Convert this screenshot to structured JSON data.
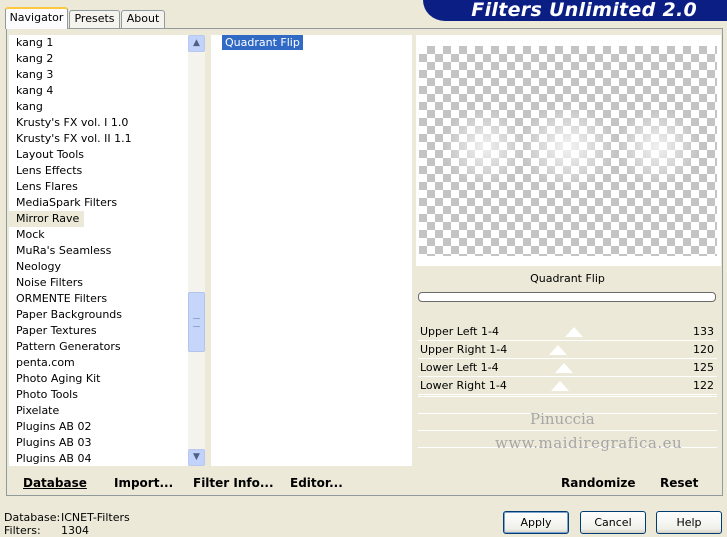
{
  "tabs": [
    "Navigator",
    "Presets",
    "About"
  ],
  "banner_title": "Filters Unlimited 2.0",
  "categories": [
    "kang 1",
    "kang 2",
    "kang 3",
    "kang 4",
    "kang",
    "Krusty's FX vol. I 1.0",
    "Krusty's FX vol. II 1.1",
    "Layout Tools",
    "Lens Effects",
    "Lens Flares",
    "MediaSpark Filters",
    "Mirror Rave",
    "Mock",
    "MuRa's Seamless",
    "Neology",
    "Noise Filters",
    "ORMENTE Filters",
    "Paper Backgrounds",
    "Paper Textures",
    "Pattern Generators",
    "penta.com",
    "Photo Aging Kit",
    "Photo Tools",
    "Pixelate",
    "Plugins AB 02",
    "Plugins AB 03",
    "Plugins AB 04"
  ],
  "selected_category": "Mirror Rave",
  "filters": [
    "Quadrant Flip"
  ],
  "selected_filter": "Quadrant Flip",
  "filter_title": "Quadrant Flip",
  "sliders": [
    {
      "label": "Upper Left 1-4",
      "value": "133"
    },
    {
      "label": "Upper Right 1-4",
      "value": "120"
    },
    {
      "label": "Lower Left 1-4",
      "value": "125"
    },
    {
      "label": "Lower Right 1-4",
      "value": "122"
    }
  ],
  "watermark": {
    "line1": "Pinuccia",
    "line2": "www.maidiregrafica.eu"
  },
  "toolbar": {
    "database": "Database",
    "import": "Import...",
    "filter_info": "Filter Info...",
    "editor": "Editor...",
    "randomize": "Randomize",
    "reset": "Reset"
  },
  "status": {
    "database_label": "Database:",
    "database_value": "ICNET-Filters",
    "filters_label": "Filters:",
    "filters_value": "1304"
  },
  "buttons": {
    "apply": "Apply",
    "cancel": "Cancel",
    "help": "Help"
  },
  "icons": {
    "scroll_up": "chevron-up-icon",
    "scroll_down": "chevron-down-icon",
    "scroll_grip": "grip-icon"
  }
}
